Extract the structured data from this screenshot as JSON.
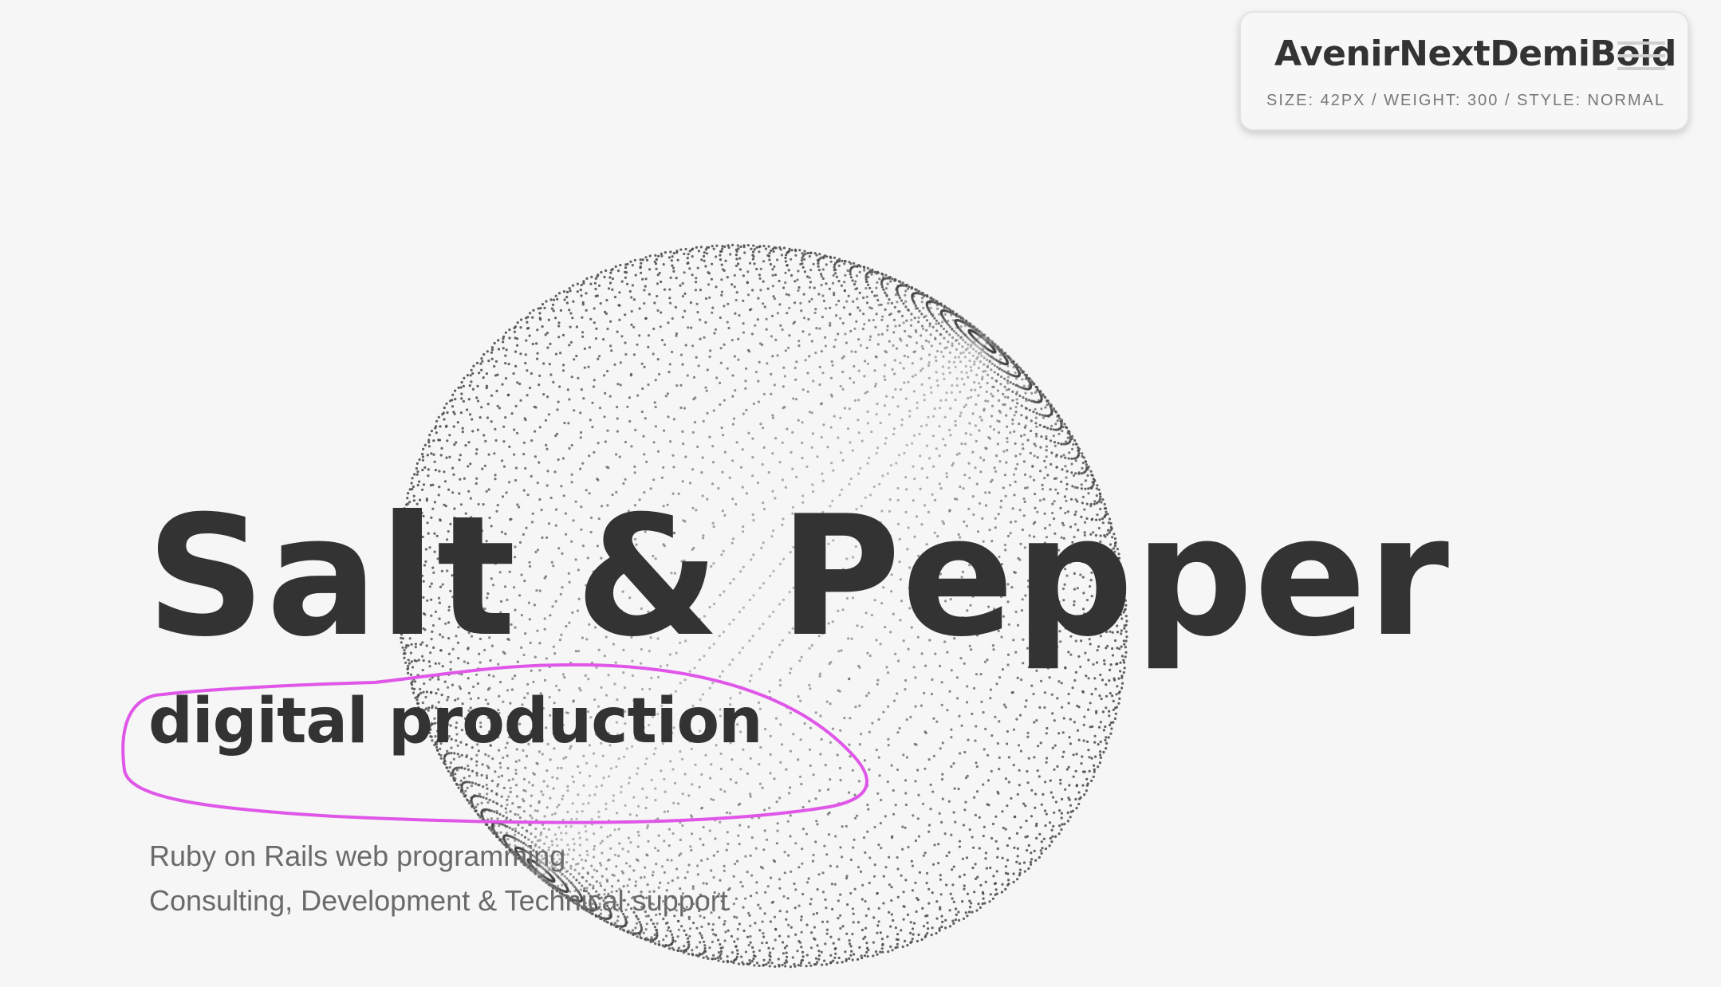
{
  "hero": {
    "title": "Salt & Pepper",
    "subtitle": "digital production",
    "services": [
      "Ruby on Rails web programming",
      "Consulting, Development & Technical support"
    ]
  },
  "font_inspector": {
    "font_name": "AvenirNextDemiBold",
    "specs": "SIZE: 42PX / WEIGHT: 300 / STYLE: NORMAL"
  },
  "icons": {
    "menu": "hamburger-menu-icon"
  },
  "colors": {
    "background": "#f6f6f6",
    "text_primary": "#333333",
    "text_secondary": "#6a6a6a",
    "annotation": "#e056e8",
    "dots": "#444444"
  }
}
